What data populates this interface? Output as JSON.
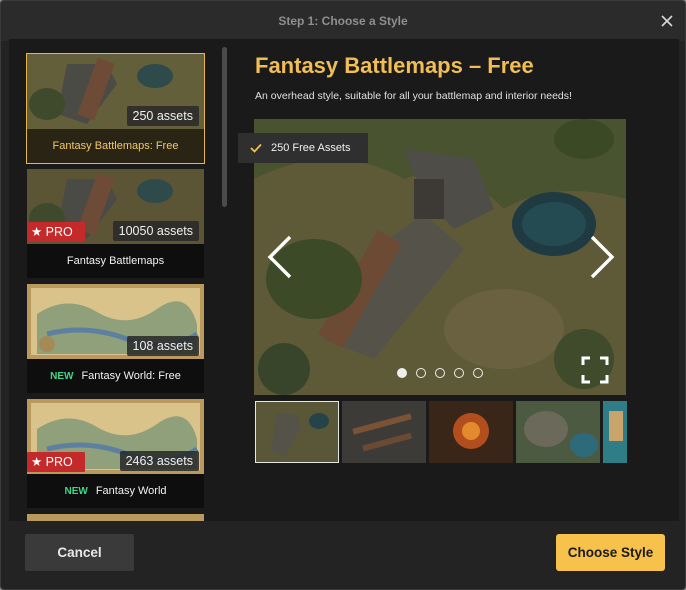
{
  "dialog": {
    "title": "Step 1: Choose a Style"
  },
  "sidebar": {
    "items": [
      {
        "assets": "250 assets",
        "label": "Fantasy Battlemaps: Free",
        "pro": false,
        "new": false,
        "selected": true
      },
      {
        "assets": "10050 assets",
        "label": "Fantasy Battlemaps",
        "pro": true,
        "new": false,
        "selected": false
      },
      {
        "assets": "108 assets",
        "label": "Fantasy World: Free",
        "pro": false,
        "new": true,
        "selected": false
      },
      {
        "assets": "2463 assets",
        "label": "Fantasy World",
        "pro": true,
        "new": true,
        "selected": false
      }
    ],
    "pro_label": "★ PRO",
    "new_label": "NEW"
  },
  "main": {
    "heading": "Fantasy Battlemaps – Free",
    "description": "An overhead style, suitable for all your battlemap and interior needs!",
    "badge": "250 Free Assets",
    "carousel": {
      "slide_count": 5,
      "active_index": 0
    }
  },
  "footer": {
    "cancel_label": "Cancel",
    "choose_label": "Choose Style"
  },
  "colors": {
    "accent": "#f7c24c",
    "heading": "#f1be55",
    "pro": "#c42a2a",
    "new": "#3fd68b"
  }
}
